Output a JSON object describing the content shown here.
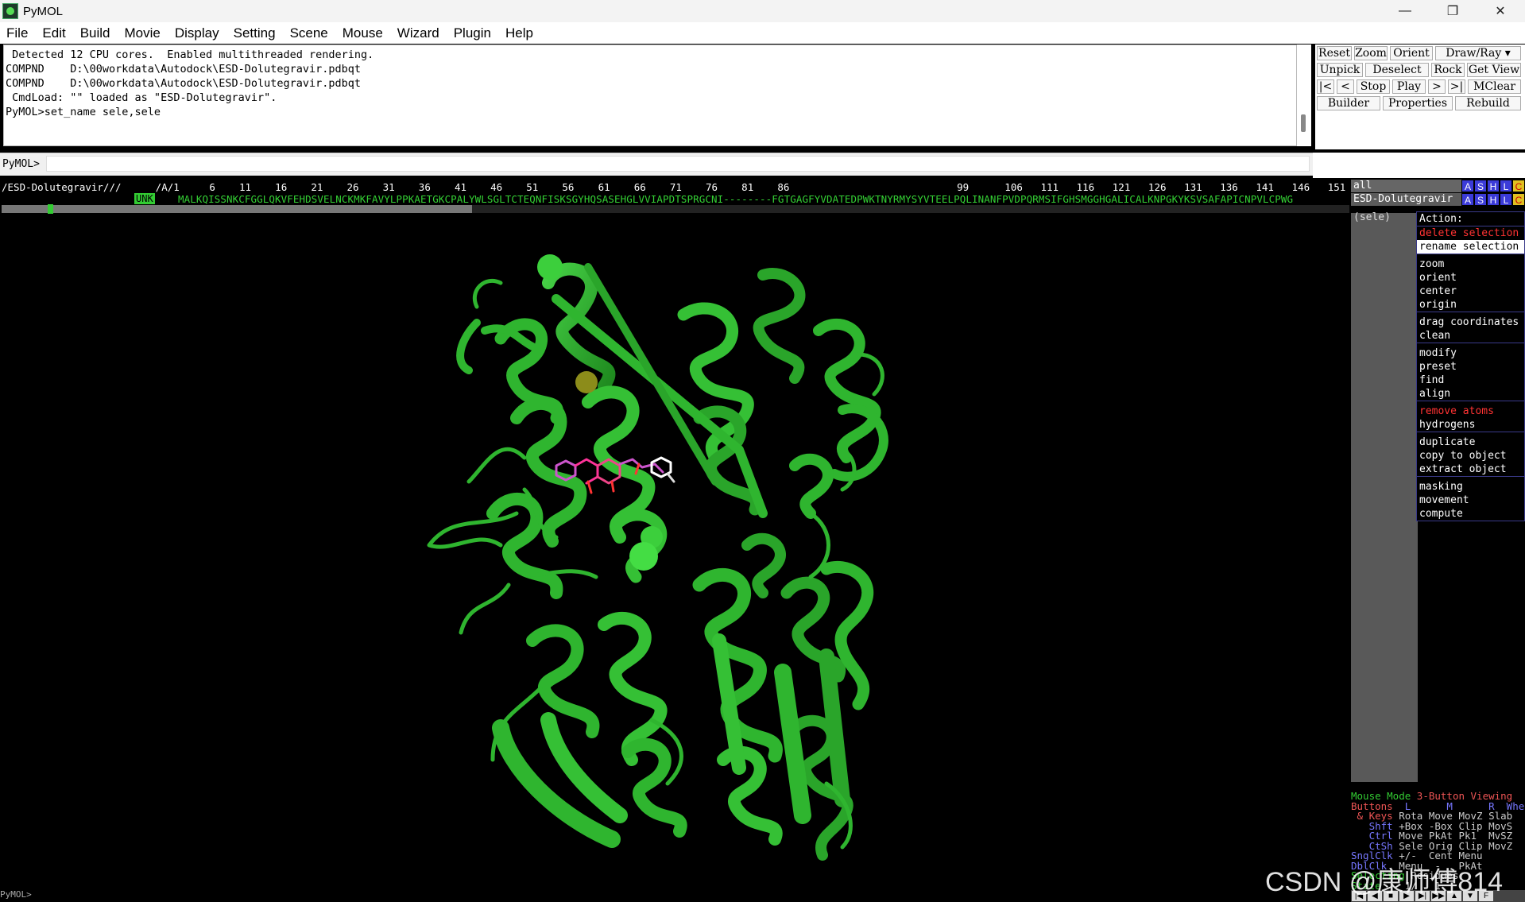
{
  "window": {
    "title": "PyMOL",
    "icon": "pymol-logo-icon"
  },
  "menu": [
    "File",
    "Edit",
    "Build",
    "Movie",
    "Display",
    "Setting",
    "Scene",
    "Mouse",
    "Wizard",
    "Plugin",
    "Help"
  ],
  "output": {
    "lines": [
      " Detected 12 CPU cores.  Enabled multithreaded rendering.",
      "",
      "COMPND    D:\\00workdata\\Autodock\\ESD-Dolutegravir.pdbqt",
      "COMPND    D:\\00workdata\\Autodock\\ESD-Dolutegravir.pdbqt",
      " CmdLoad: \"\" loaded as \"ESD-Dolutegravir\".",
      "PyMOL>set_name sele,sele"
    ]
  },
  "command": {
    "prompt": "PyMOL>",
    "value": ""
  },
  "external_buttons": {
    "row1": [
      "Reset",
      "Zoom",
      "Orient",
      "Draw/Ray ▾"
    ],
    "row2": [
      "Unpick",
      "Deselect",
      "Rock",
      "Get View"
    ],
    "row3": [
      "|<",
      "<",
      "Stop",
      "Play",
      ">",
      ">|",
      "MClear"
    ],
    "row4": [
      "Builder",
      "Properties",
      "Rebuild"
    ]
  },
  "sequence": {
    "object_label": "/ESD-Dolutegravir///",
    "chain_label": "/A/1",
    "numbers": "                          /A/1     6    11    16    21    26    31    36    41    46    51    56    61    66    71    76    81    86                            99      106   111   116   121   126   131   136   141   146   151   156   161   166   171   176   181",
    "unk": "UNK",
    "residues": "MALKQISSNKCFGGLQKVFEHDSVELNCKMKFAVYLPPKAETGKCPALYWLSGLTCTEQNFISKSGYHQSASEHGLVVIAPDTSPRGCNI--------FGTGAGFYVDATEDPWKTNYRMYSYVTEELPQLINANFPVDPQRMSIFGHSMGGHGALICALKNPGKYKSVSAFAPICNPVLCPWG"
  },
  "objects": {
    "all_label": "all",
    "object_label": "ESD-Dolutegravir",
    "sele_label": "(sele)",
    "buttons": [
      "A",
      "S",
      "H",
      "L",
      "C"
    ]
  },
  "action_menu": {
    "title": "Action:",
    "items": {
      "delete": "delete selection",
      "rename": "rename selection",
      "zoom": "zoom",
      "orient": "orient",
      "center": "center",
      "origin": "origin",
      "drag": "drag coordinates",
      "clean": "clean",
      "modify": "modify",
      "preset": "preset",
      "find": "find",
      "align": "align",
      "remove": "remove atoms",
      "hydrogens": "hydrogens",
      "duplicate": "duplicate",
      "copy": "copy to object",
      "extract": "extract object",
      "masking": "masking",
      "movement": "movement",
      "compute": "compute"
    }
  },
  "mouse_mode": {
    "l1a": "Mouse Mode ",
    "l1b": "3-Button Viewing",
    "l2a": "Buttons ",
    "l2b": " L      M      R  Wheel",
    "l3a": " & Keys ",
    "l3b": "Rota Move MovZ Slab",
    "l4a": "   Shft ",
    "l4b": "+Box -Box Clip MovS",
    "l5a": "   Ctrl ",
    "l5b": "Move PkAt Pk1  MvSZ",
    "l6a": "   CtSh ",
    "l6b": "Sele Orig Clip MovZ",
    "l7a": "SnglClk ",
    "l7b": "+/-  Cent Menu",
    "l8a": "DblClk  ",
    "l8b": "Menu  -   PkAt",
    "l9a": "Selecting ",
    "l9b": "Residues",
    "l10a": "State ",
    "l10b": "   1/   1"
  },
  "bottom_prompt": "PyMOL>",
  "watermark": "CSDN @康师傅814",
  "colors": {
    "protein": "#2fb52f",
    "sequence": "#34d134",
    "menu_border": "#3a3a8a",
    "delete_red": "#ff3333"
  }
}
